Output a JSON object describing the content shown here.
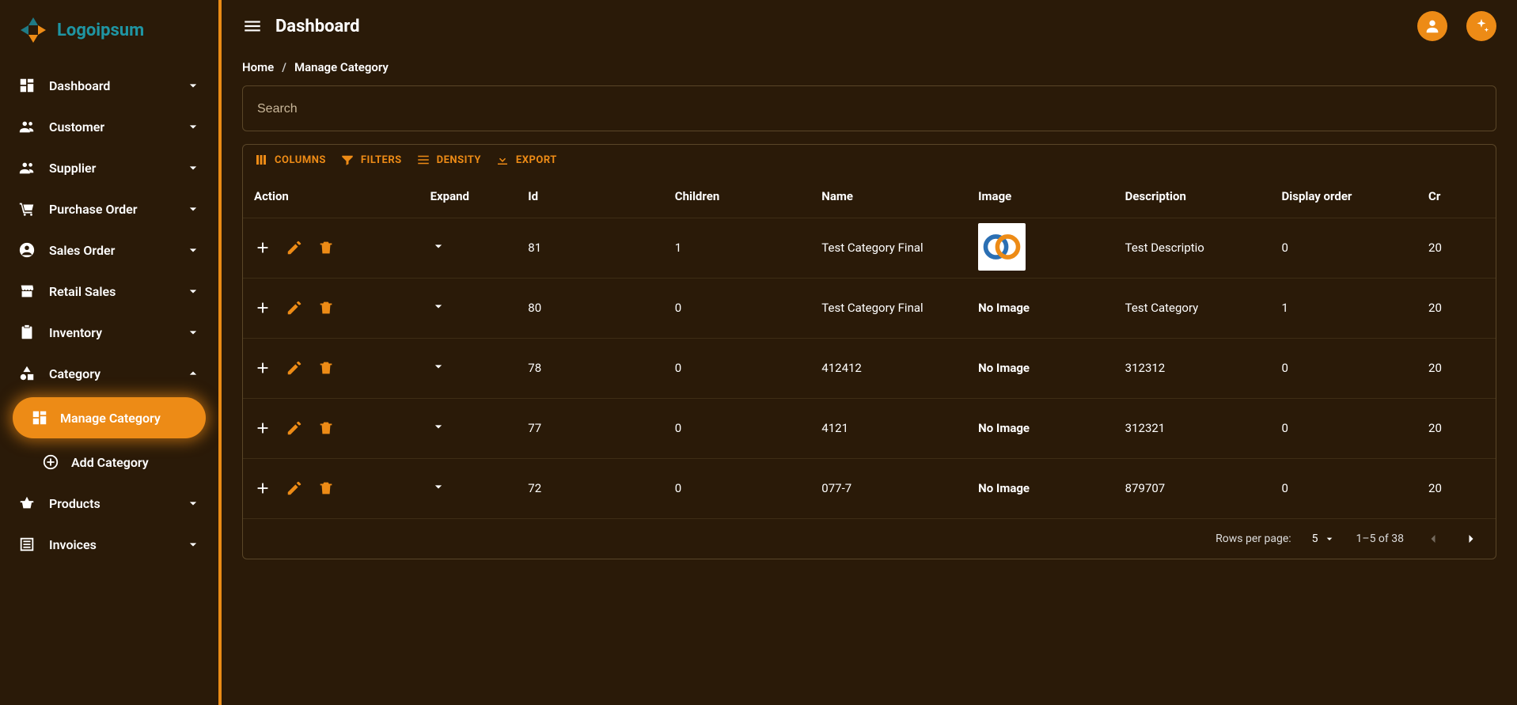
{
  "brand": {
    "name": "Logoipsum"
  },
  "header": {
    "title": "Dashboard"
  },
  "breadcrumb": {
    "home": "Home",
    "current": "Manage Category"
  },
  "search": {
    "placeholder": "Search"
  },
  "sidebar": {
    "items": [
      {
        "label": "Dashboard",
        "icon": "dashboard"
      },
      {
        "label": "Customer",
        "icon": "group"
      },
      {
        "label": "Supplier",
        "icon": "group"
      },
      {
        "label": "Purchase Order",
        "icon": "cart"
      },
      {
        "label": "Sales Order",
        "icon": "account"
      },
      {
        "label": "Retail Sales",
        "icon": "store"
      },
      {
        "label": "Inventory",
        "icon": "clipboard"
      },
      {
        "label": "Category",
        "icon": "shapes",
        "expanded": true
      },
      {
        "label": "Products",
        "icon": "basket"
      },
      {
        "label": "Invoices",
        "icon": "list"
      }
    ],
    "categorySub": [
      {
        "label": "Manage Category",
        "icon": "dashboard",
        "active": true
      },
      {
        "label": "Add Category",
        "icon": "add-circle"
      }
    ]
  },
  "toolbar": {
    "columns": "COLUMNS",
    "filters": "FILTERS",
    "density": "DENSITY",
    "export": "EXPORT"
  },
  "table": {
    "headers": {
      "action": "Action",
      "expand": "Expand",
      "id": "Id",
      "children": "Children",
      "name": "Name",
      "image": "Image",
      "description": "Description",
      "order": "Display order",
      "created": "Cr"
    },
    "noImage": "No Image",
    "rows": [
      {
        "id": "81",
        "children": "1",
        "name": "Test Category Final",
        "hasImage": true,
        "description": "Test Descriptio",
        "order": "0",
        "created": "20"
      },
      {
        "id": "80",
        "children": "0",
        "name": "Test Category Final",
        "hasImage": false,
        "description": "Test Category",
        "order": "1",
        "created": "20"
      },
      {
        "id": "78",
        "children": "0",
        "name": "412412",
        "hasImage": false,
        "description": "312312",
        "order": "0",
        "created": "20"
      },
      {
        "id": "77",
        "children": "0",
        "name": "4121",
        "hasImage": false,
        "description": "312321",
        "order": "0",
        "created": "20"
      },
      {
        "id": "72",
        "children": "0",
        "name": "077-7",
        "hasImage": false,
        "description": "879707",
        "order": "0",
        "created": "20"
      }
    ]
  },
  "pager": {
    "rowsLabel": "Rows per page:",
    "rowsValue": "5",
    "range": "1–5 of 38"
  }
}
